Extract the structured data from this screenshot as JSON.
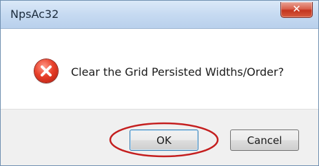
{
  "window": {
    "title": "NpsAc32",
    "close_glyph": "✕"
  },
  "dialog": {
    "icon": "error-icon",
    "message": "Clear the Grid Persisted Widths/Order?"
  },
  "buttons": {
    "ok_label": "OK",
    "cancel_label": "Cancel"
  },
  "colors": {
    "annotation_ellipse": "#c41e1e",
    "error_icon": "#d83a24",
    "titlebar": "#c6daf1"
  }
}
